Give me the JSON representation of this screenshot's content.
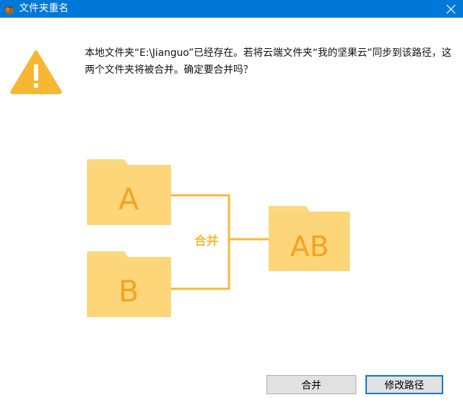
{
  "title_bar": {
    "title": "文件夹重名",
    "app_icon": "jianguoyun-acorn-icon",
    "close_icon": "close-icon"
  },
  "message": {
    "text": "本地文件夹“E:\\Jianguo”已经存在。若将云端文件夹“我的坚果云”同步到该路径，这两个文件夹将被合并。确定要合并吗？"
  },
  "diagram": {
    "folder_a": "A",
    "folder_b": "B",
    "merge_label": "合并",
    "folder_ab": "AB"
  },
  "buttons": {
    "merge": "合并",
    "change_path": "修改路径"
  },
  "colors": {
    "titlebar": "#0078d7",
    "warning": "#f7b733",
    "folder": "#fbd981",
    "folder_text": "#f5a320",
    "connector": "#f7b733"
  }
}
